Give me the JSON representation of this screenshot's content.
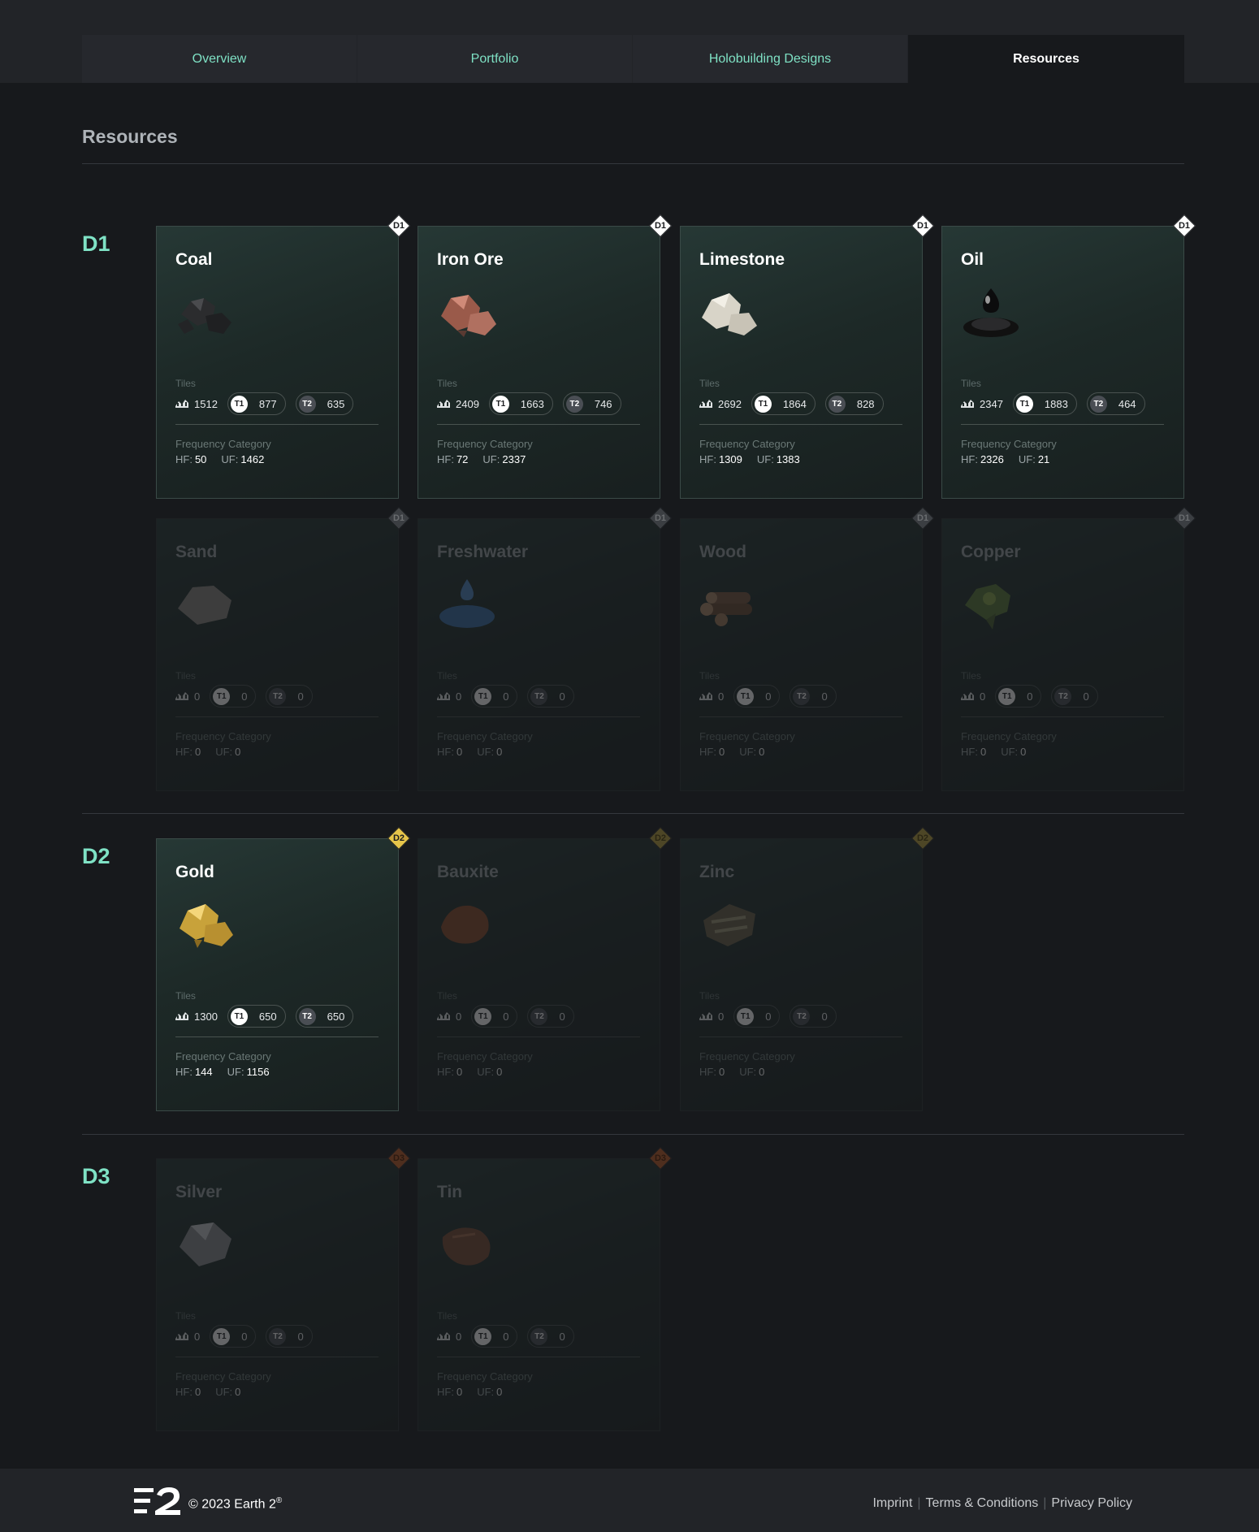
{
  "tabs": [
    {
      "label": "Overview"
    },
    {
      "label": "Portfolio"
    },
    {
      "label": "Holobuilding Designs"
    },
    {
      "label": "Resources"
    }
  ],
  "page_title": "Resources",
  "tiles_label": "Tiles",
  "frequency_label": "Frequency Category",
  "hf_label": "HF:",
  "uf_label": "UF:",
  "t1_badge": "T1",
  "t2_badge": "T2",
  "sections": [
    {
      "label": "D1",
      "tier": "D1"
    },
    {
      "label": "D2",
      "tier": "D2"
    },
    {
      "label": "D3",
      "tier": "D3"
    }
  ],
  "resources": [
    {
      "name": "Coal",
      "tier": "D1",
      "active": true,
      "tiles": "1512",
      "t1": "877",
      "t2": "635",
      "hf": "50",
      "uf": "1462",
      "icon": "coal-icon"
    },
    {
      "name": "Iron Ore",
      "tier": "D1",
      "active": true,
      "tiles": "2409",
      "t1": "1663",
      "t2": "746",
      "hf": "72",
      "uf": "2337",
      "icon": "iron-ore-icon"
    },
    {
      "name": "Limestone",
      "tier": "D1",
      "active": true,
      "tiles": "2692",
      "t1": "1864",
      "t2": "828",
      "hf": "1309",
      "uf": "1383",
      "icon": "limestone-icon"
    },
    {
      "name": "Oil",
      "tier": "D1",
      "active": true,
      "tiles": "2347",
      "t1": "1883",
      "t2": "464",
      "hf": "2326",
      "uf": "21",
      "icon": "oil-icon"
    },
    {
      "name": "Sand",
      "tier": "D1",
      "active": false,
      "tiles": "0",
      "t1": "0",
      "t2": "0",
      "hf": "0",
      "uf": "0",
      "icon": "sand-icon"
    },
    {
      "name": "Freshwater",
      "tier": "D1",
      "active": false,
      "tiles": "0",
      "t1": "0",
      "t2": "0",
      "hf": "0",
      "uf": "0",
      "icon": "freshwater-icon"
    },
    {
      "name": "Wood",
      "tier": "D1",
      "active": false,
      "tiles": "0",
      "t1": "0",
      "t2": "0",
      "hf": "0",
      "uf": "0",
      "icon": "wood-icon"
    },
    {
      "name": "Copper",
      "tier": "D1",
      "active": false,
      "tiles": "0",
      "t1": "0",
      "t2": "0",
      "hf": "0",
      "uf": "0",
      "icon": "copper-icon"
    },
    {
      "name": "Gold",
      "tier": "D2",
      "active": true,
      "tiles": "1300",
      "t1": "650",
      "t2": "650",
      "hf": "144",
      "uf": "1156",
      "icon": "gold-icon"
    },
    {
      "name": "Bauxite",
      "tier": "D2",
      "active": false,
      "tiles": "0",
      "t1": "0",
      "t2": "0",
      "hf": "0",
      "uf": "0",
      "icon": "bauxite-icon"
    },
    {
      "name": "Zinc",
      "tier": "D2",
      "active": false,
      "tiles": "0",
      "t1": "0",
      "t2": "0",
      "hf": "0",
      "uf": "0",
      "icon": "zinc-icon"
    },
    {
      "name": "Silver",
      "tier": "D3",
      "active": false,
      "tiles": "0",
      "t1": "0",
      "t2": "0",
      "hf": "0",
      "uf": "0",
      "icon": "silver-icon"
    },
    {
      "name": "Tin",
      "tier": "D3",
      "active": false,
      "tiles": "0",
      "t1": "0",
      "t2": "0",
      "hf": "0",
      "uf": "0",
      "icon": "tin-icon"
    }
  ],
  "footer": {
    "copyright": "© 2023 Earth 2",
    "registered": "®",
    "links": [
      {
        "label": "Imprint"
      },
      {
        "label": "Terms & Conditions"
      },
      {
        "label": "Privacy Policy"
      }
    ]
  },
  "colors": {
    "accent": "#7fe2c5",
    "gold_tier": "#e6c54a",
    "bronze_tier": "#7a4428",
    "background": "#17191c"
  }
}
